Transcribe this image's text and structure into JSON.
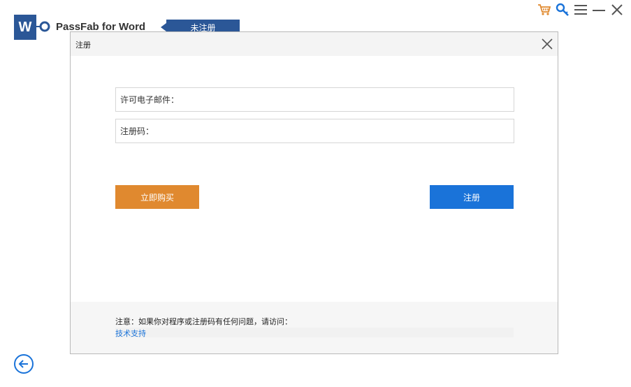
{
  "app": {
    "logo_letter": "W",
    "title": "PassFab for Word",
    "registration_status": "未注册"
  },
  "toolbar": {
    "icons": [
      "cart-icon",
      "key-icon",
      "menu-icon",
      "minimize-icon",
      "close-icon"
    ]
  },
  "dialog": {
    "title": "注册",
    "email_label": "许可电子邮件：",
    "email_value": "",
    "code_label": "注册码：",
    "code_value": "",
    "buy_button": "立即购买",
    "register_button": "注册",
    "note": "注意：如果你对程序或注册码有任何问题，请访问：",
    "support_link": "技术支持"
  },
  "colors": {
    "brand_blue": "#2b5797",
    "buy_orange": "#e0892f",
    "register_blue": "#1a73d9"
  }
}
